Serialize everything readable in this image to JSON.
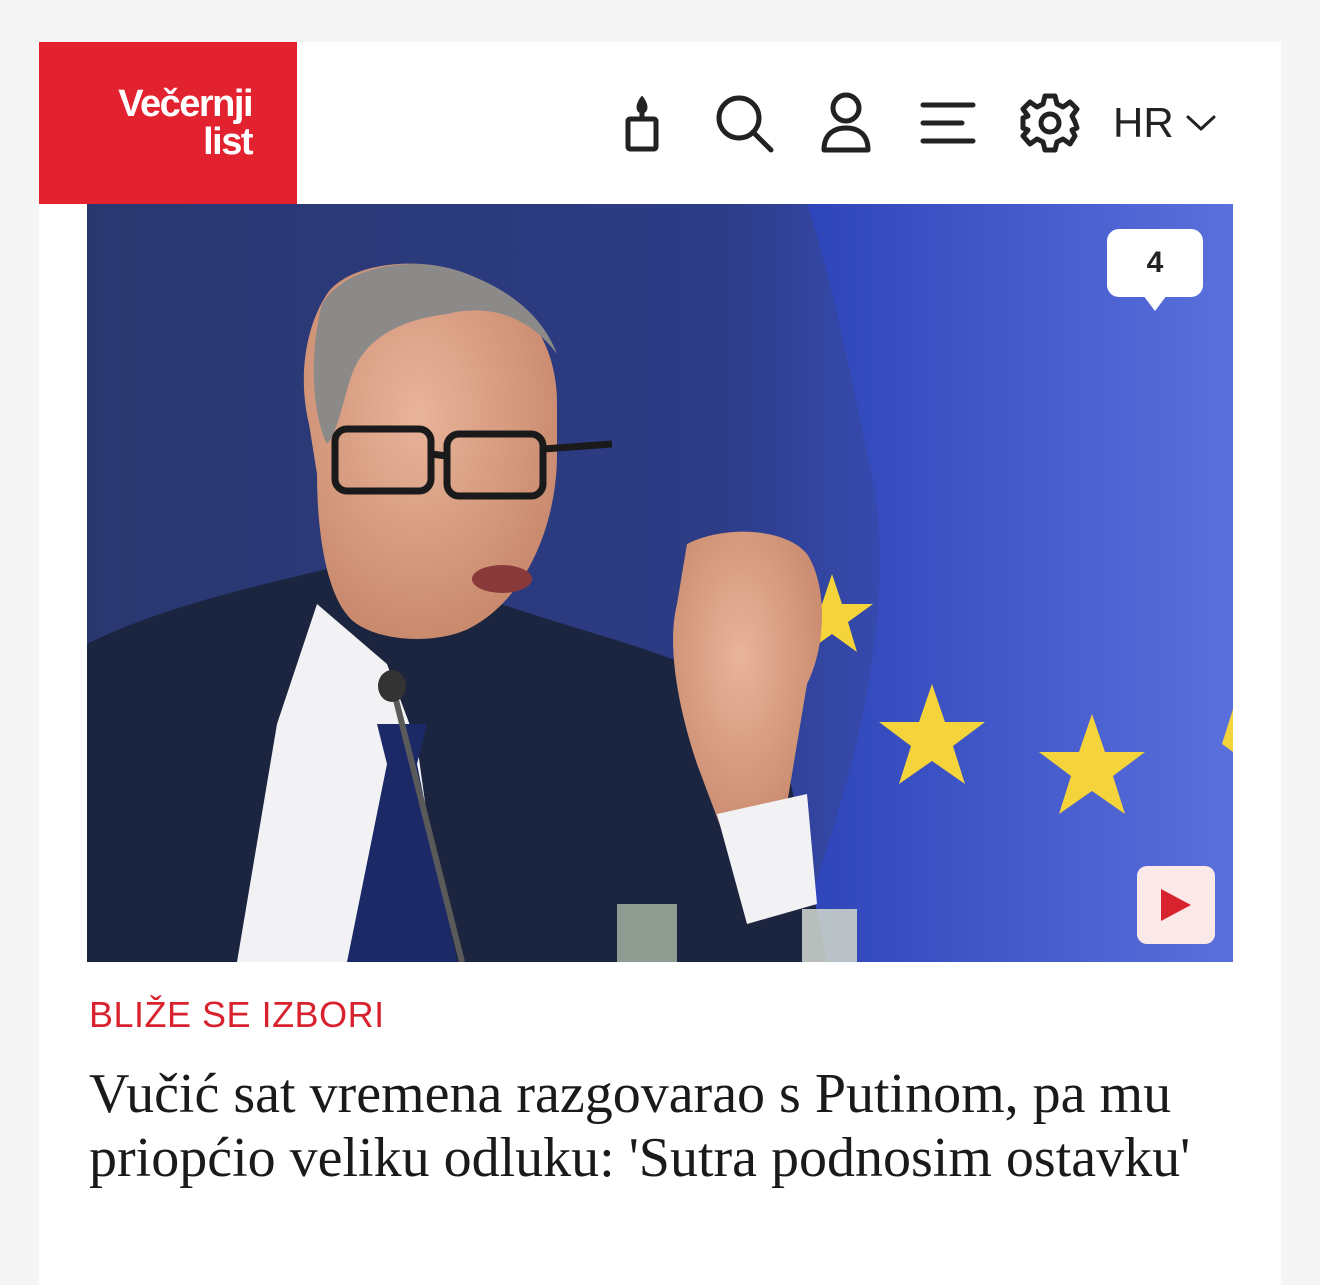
{
  "header": {
    "logo_line1": "Večernji",
    "logo_line2": "list",
    "icons": [
      "candle-icon",
      "search-icon",
      "user-icon",
      "menu-icon",
      "gear-icon"
    ],
    "language": "HR"
  },
  "article": {
    "comment_count": "4",
    "category": "BLIŽE SE IZBORI",
    "headline": "Vučić sat vremena razgovarao s Putinom, pa mu priopćio veliku odluku: 'Sutra podnosim ostavku'",
    "has_video": true
  },
  "colors": {
    "brand_red": "#e3222f",
    "category_red": "#d8232f"
  }
}
